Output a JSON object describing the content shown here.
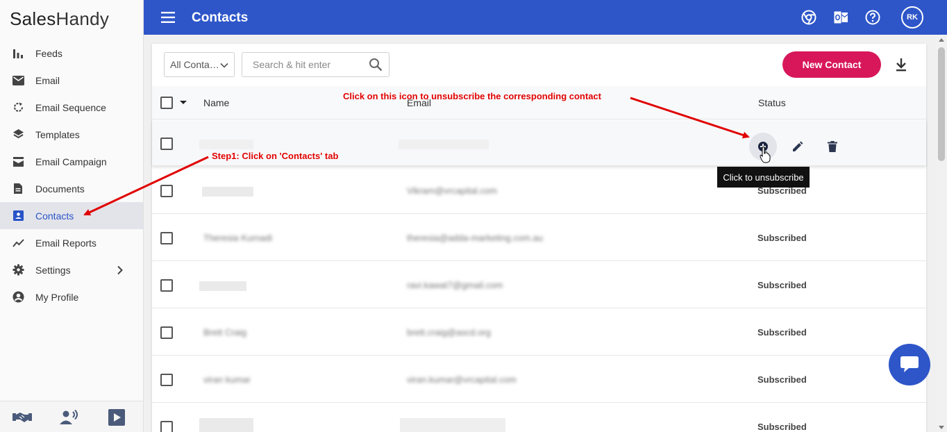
{
  "app": {
    "logo_part1": "Sales",
    "logo_part2": "Handy"
  },
  "sidebar": {
    "items": [
      {
        "label": "Feeds",
        "icon": "bar-chart-icon"
      },
      {
        "label": "Email",
        "icon": "mail-icon"
      },
      {
        "label": "Email Sequence",
        "icon": "refresh-icon"
      },
      {
        "label": "Templates",
        "icon": "layers-icon"
      },
      {
        "label": "Email Campaign",
        "icon": "inbox-icon"
      },
      {
        "label": "Documents",
        "icon": "document-icon"
      },
      {
        "label": "Contacts",
        "icon": "contact-card-icon",
        "active": true
      },
      {
        "label": "Email Reports",
        "icon": "trend-line-icon"
      },
      {
        "label": "Settings",
        "icon": "gear-icon"
      },
      {
        "label": "My Profile",
        "icon": "account-circle-icon"
      }
    ],
    "footer_icons": [
      "handshake-icon",
      "voice-person-icon",
      "play-video-icon"
    ]
  },
  "header": {
    "title": "Contacts",
    "avatar_initials": "RK",
    "icons": [
      "chrome-icon",
      "outlook-icon",
      "help-icon"
    ],
    "color": "#2e56c9"
  },
  "toolbar": {
    "filter_value": "All Conta…",
    "search_placeholder": "Search & hit enter",
    "new_contact_label": "New Contact",
    "new_contact_color": "#d8175b"
  },
  "table": {
    "columns": [
      "Name",
      "Email",
      "Status"
    ],
    "rows": [
      {
        "name": "",
        "email": "",
        "status": ""
      },
      {
        "name": "",
        "email": "Vikram@vrcapital.com",
        "status": "Subscribed"
      },
      {
        "name": "Theresia Kurnadi",
        "email": "theresia@adda-marketing.com.au",
        "status": "Subscribed"
      },
      {
        "name": "",
        "email": "ravi.kawat7@gmail.com",
        "status": "Subscribed"
      },
      {
        "name": "Brett Craig",
        "email": "brett.craig@ascd.org",
        "status": "Subscribed"
      },
      {
        "name": "viran kumar",
        "email": "viran.kumar@vrcapital.com",
        "status": "Subscribed"
      },
      {
        "name": "",
        "email": "",
        "status": "Subscribed"
      }
    ]
  },
  "row_actions": {
    "tooltip": "Click to unsubscribe"
  },
  "annotations": {
    "unsubscribe_hint": "Click on this icon to unsubscribe the corresponding contact",
    "step1": "Step1: Click on 'Contacts' tab"
  }
}
